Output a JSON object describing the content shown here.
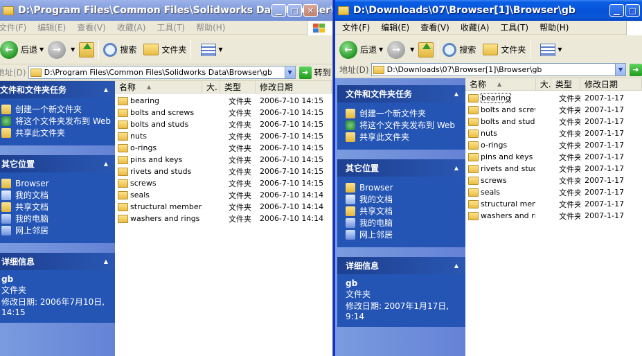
{
  "windows": [
    {
      "title": "D:\\Program Files\\Common Files\\Solidworks Data\\Browser\\gb",
      "menu": [
        "文件(F)",
        "编辑(E)",
        "查看(V)",
        "收藏(A)",
        "工具(T)",
        "帮助(H)"
      ],
      "toolbar": {
        "back": "后退",
        "search": "搜索",
        "folders": "文件夹"
      },
      "address": {
        "label": "地址(D)",
        "value": "D:\\Program Files\\Common Files\\Solidworks Data\\Browser\\gb",
        "go": "转到"
      },
      "tasks": {
        "header": "文件和文件夹任务",
        "items": [
          "创建一个新文件夹",
          "将这个文件夹发布到 Web",
          "共享此文件夹"
        ]
      },
      "places": {
        "header": "其它位置",
        "items": [
          "Browser",
          "我的文档",
          "共享文档",
          "我的电脑",
          "网上邻居"
        ]
      },
      "details": {
        "header": "详细信息",
        "name": "gb",
        "type": "文件夹",
        "modified": "修改日期: 2006年7月10日, 14:15"
      },
      "columns": [
        "名称",
        "大.",
        "类型",
        "修改日期"
      ],
      "files": [
        {
          "name": "bearing",
          "type": "文件夹",
          "date": "2006-7-10 14:15"
        },
        {
          "name": "bolts and screws",
          "type": "文件夹",
          "date": "2006-7-10 14:15"
        },
        {
          "name": "bolts and studs",
          "type": "文件夹",
          "date": "2006-7-10 14:15"
        },
        {
          "name": "nuts",
          "type": "文件夹",
          "date": "2006-7-10 14:15"
        },
        {
          "name": "o-rings",
          "type": "文件夹",
          "date": "2006-7-10 14:15"
        },
        {
          "name": "pins and keys",
          "type": "文件夹",
          "date": "2006-7-10 14:15"
        },
        {
          "name": "rivets and studs",
          "type": "文件夹",
          "date": "2006-7-10 14:15"
        },
        {
          "name": "screws",
          "type": "文件夹",
          "date": "2006-7-10 14:15"
        },
        {
          "name": "seals",
          "type": "文件夹",
          "date": "2006-7-10 14:14"
        },
        {
          "name": "structural members",
          "type": "文件夹",
          "date": "2006-7-10 14:14"
        },
        {
          "name": "washers and rings",
          "type": "文件夹",
          "date": "2006-7-10 14:14"
        }
      ]
    },
    {
      "title": "D:\\Downloads\\07\\Browser[1]\\Browser\\gb",
      "menu": [
        "文件(F)",
        "编辑(E)",
        "查看(V)",
        "收藏(A)",
        "工具(T)",
        "帮助(H)"
      ],
      "toolbar": {
        "back": "后退",
        "search": "搜索",
        "folders": "文件夹"
      },
      "address": {
        "label": "地址(D)",
        "value": "D:\\Downloads\\07\\Browser[1]\\Browser\\gb",
        "go": ""
      },
      "tasks": {
        "header": "文件和文件夹任务",
        "items": [
          "创建一个新文件夹",
          "将这个文件夹发布到 Web",
          "共享此文件夹"
        ]
      },
      "places": {
        "header": "其它位置",
        "items": [
          "Browser",
          "我的文档",
          "共享文档",
          "我的电脑",
          "网上邻居"
        ]
      },
      "details": {
        "header": "详细信息",
        "name": "gb",
        "type": "文件夹",
        "modified": "修改日期: 2007年1月17日, 9:14"
      },
      "columns": [
        "名称",
        "大.",
        "类型",
        "修改日期"
      ],
      "files": [
        {
          "name": "bearing",
          "type": "文件夹",
          "date": "2007-1-17"
        },
        {
          "name": "bolts and screws",
          "type": "文件夹",
          "date": "2007-1-17"
        },
        {
          "name": "bolts and studs",
          "type": "文件夹",
          "date": "2007-1-17"
        },
        {
          "name": "nuts",
          "type": "文件夹",
          "date": "2007-1-17"
        },
        {
          "name": "o-rings",
          "type": "文件夹",
          "date": "2007-1-17"
        },
        {
          "name": "pins and keys",
          "type": "文件夹",
          "date": "2007-1-17"
        },
        {
          "name": "rivets and studs",
          "type": "文件夹",
          "date": "2007-1-17"
        },
        {
          "name": "screws",
          "type": "文件夹",
          "date": "2007-1-17"
        },
        {
          "name": "seals",
          "type": "文件夹",
          "date": "2007-1-17"
        },
        {
          "name": "structural members",
          "type": "文件夹",
          "date": "2007-1-17"
        },
        {
          "name": "washers and rings",
          "type": "文件夹",
          "date": "2007-1-17"
        }
      ]
    }
  ]
}
